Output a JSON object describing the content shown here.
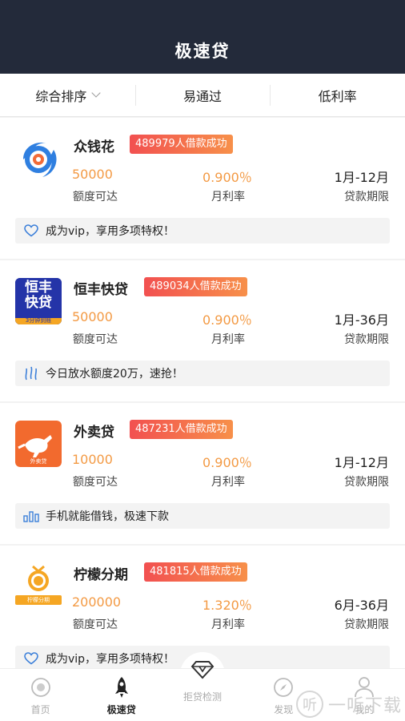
{
  "header": {
    "title": "极速贷"
  },
  "filters": [
    "综合排序",
    "易通过",
    "低利率"
  ],
  "products": [
    {
      "name": "众钱花",
      "badge": "489979人借款成功",
      "amount": "50000",
      "amount_label": "额度可达",
      "rate": "0.900％",
      "rate_label": "月利率",
      "term": "1月-12月",
      "term_label": "贷款期限",
      "note": "成为vip，享用多项特权！",
      "note_icon": "heart-icon",
      "logo_icon": "spiral-logo"
    },
    {
      "name": "恒丰快贷",
      "badge": "489034人借款成功",
      "amount": "50000",
      "amount_label": "额度可达",
      "rate": "0.900％",
      "rate_label": "月利率",
      "term": "1月-36月",
      "term_label": "贷款期限",
      "note": "今日放水额度20万，速抢！",
      "note_icon": "water-icon",
      "logo_icon": "hengfeng-logo",
      "logo_text_top": "恒丰",
      "logo_text_bottom": "快贷",
      "logo_sub": "3分钟到账"
    },
    {
      "name": "外卖贷",
      "badge": "487231人借款成功",
      "amount": "10000",
      "amount_label": "额度可达",
      "rate": "0.900％",
      "rate_label": "月利率",
      "term": "1月-12月",
      "term_label": "贷款期限",
      "note": "手机就能借钱，极速下款",
      "note_icon": "bar-chart-icon",
      "logo_icon": "kangaroo-logo",
      "logo_sub": "外卖贷"
    },
    {
      "name": "柠檬分期",
      "badge": "481815人借款成功",
      "amount": "200000",
      "amount_label": "额度可达",
      "rate": "1.320％",
      "rate_label": "月利率",
      "term": "6月-36月",
      "term_label": "贷款期限",
      "note": "成为vip，享用多项特权！",
      "note_icon": "heart-icon",
      "logo_icon": "coin-logo",
      "logo_sub": "柠檬分期"
    }
  ],
  "tabs": [
    {
      "label": "首页",
      "icon": "home-icon"
    },
    {
      "label": "极速贷",
      "icon": "rocket-icon"
    },
    {
      "label": "拒贷检测",
      "icon": "diamond-icon"
    },
    {
      "label": "发现",
      "icon": "compass-icon"
    },
    {
      "label": "我的",
      "icon": "user-icon"
    }
  ],
  "watermark": {
    "glyph": "听",
    "text": "一听下载"
  },
  "colors": {
    "header": "#232a3a",
    "accent": "#f39a44",
    "badge_start": "#f25050",
    "badge_end": "#f7904a"
  }
}
